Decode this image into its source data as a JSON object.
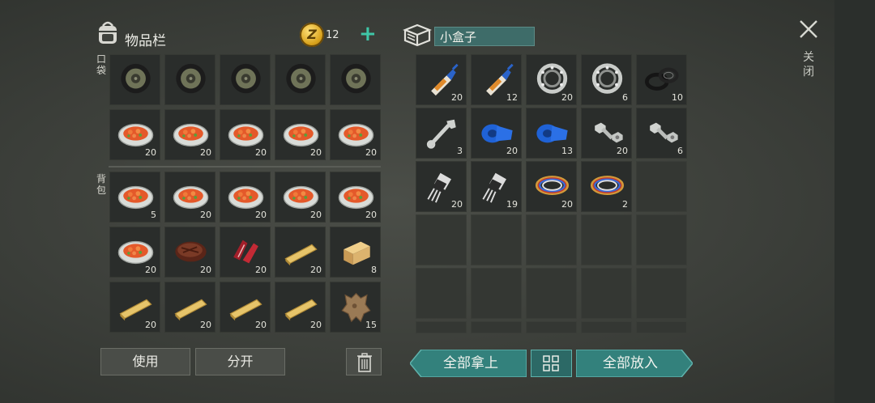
{
  "inventory": {
    "title": "物品栏",
    "coins": "12",
    "add_label": "+",
    "pocket_label": "口袋",
    "backpack_label": "背包",
    "slots": [
      {
        "item": "tire-icon",
        "qty": ""
      },
      {
        "item": "tire-icon",
        "qty": ""
      },
      {
        "item": "tire-icon",
        "qty": ""
      },
      {
        "item": "tire-icon",
        "qty": ""
      },
      {
        "item": "tire-icon",
        "qty": ""
      },
      {
        "item": "stew-plate-icon",
        "qty": "20"
      },
      {
        "item": "stew-plate-icon",
        "qty": "20"
      },
      {
        "item": "stew-plate-icon",
        "qty": "20"
      },
      {
        "item": "stew-plate-icon",
        "qty": "20"
      },
      {
        "item": "stew-plate-icon",
        "qty": "20"
      },
      {
        "item": "stew-plate-icon",
        "qty": "5"
      },
      {
        "item": "stew-plate-icon",
        "qty": "20"
      },
      {
        "item": "stew-plate-icon",
        "qty": "20"
      },
      {
        "item": "stew-plate-icon",
        "qty": "20"
      },
      {
        "item": "stew-plate-icon",
        "qty": "20"
      },
      {
        "item": "stew-plate-icon",
        "qty": "20"
      },
      {
        "item": "steak-icon",
        "qty": "20"
      },
      {
        "item": "raw-meat-icon",
        "qty": "20"
      },
      {
        "item": "plank-icon",
        "qty": "20"
      },
      {
        "item": "wood-block-icon",
        "qty": "8"
      },
      {
        "item": "plank-icon",
        "qty": "20"
      },
      {
        "item": "plank-icon",
        "qty": "20"
      },
      {
        "item": "plank-icon",
        "qty": "20"
      },
      {
        "item": "plank-icon",
        "qty": "20"
      },
      {
        "item": "leather-hide-icon",
        "qty": "15"
      }
    ],
    "use_label": "使用",
    "split_label": "分开"
  },
  "container": {
    "name": "小盒子",
    "slots": [
      {
        "item": "glue-icon",
        "qty": "20"
      },
      {
        "item": "glue-icon",
        "qty": "12"
      },
      {
        "item": "bearing-icon",
        "qty": "20"
      },
      {
        "item": "bearing-icon",
        "qty": "6"
      },
      {
        "item": "rubber-seal-icon",
        "qty": "10"
      },
      {
        "item": "wrench-icon",
        "qty": "3"
      },
      {
        "item": "duct-tape-icon",
        "qty": "20"
      },
      {
        "item": "duct-tape-icon",
        "qty": "13"
      },
      {
        "item": "bolt-nut-icon",
        "qty": "20"
      },
      {
        "item": "bolt-nut-icon",
        "qty": "6"
      },
      {
        "item": "transistor-icon",
        "qty": "20"
      },
      {
        "item": "transistor-icon",
        "qty": "19"
      },
      {
        "item": "wire-coil-icon",
        "qty": "20"
      },
      {
        "item": "wire-coil-icon",
        "qty": "2"
      },
      {
        "item": "",
        "qty": ""
      },
      {
        "item": "",
        "qty": ""
      },
      {
        "item": "",
        "qty": ""
      },
      {
        "item": "",
        "qty": ""
      },
      {
        "item": "",
        "qty": ""
      },
      {
        "item": "",
        "qty": ""
      },
      {
        "item": "",
        "qty": ""
      },
      {
        "item": "",
        "qty": ""
      },
      {
        "item": "",
        "qty": ""
      },
      {
        "item": "",
        "qty": ""
      },
      {
        "item": "",
        "qty": ""
      },
      {
        "item": "",
        "qty": ""
      },
      {
        "item": "",
        "qty": ""
      },
      {
        "item": "",
        "qty": ""
      },
      {
        "item": "",
        "qty": ""
      },
      {
        "item": "",
        "qty": ""
      }
    ],
    "take_all_label": "全部拿上",
    "put_all_label": "全部放入"
  },
  "close_label": "关闭",
  "colors": {
    "accent_teal": "#3a8a85",
    "teal_dark": "#2c6a67",
    "coin_gold": "#e0aa22",
    "plus_green": "#3fc7a8"
  }
}
